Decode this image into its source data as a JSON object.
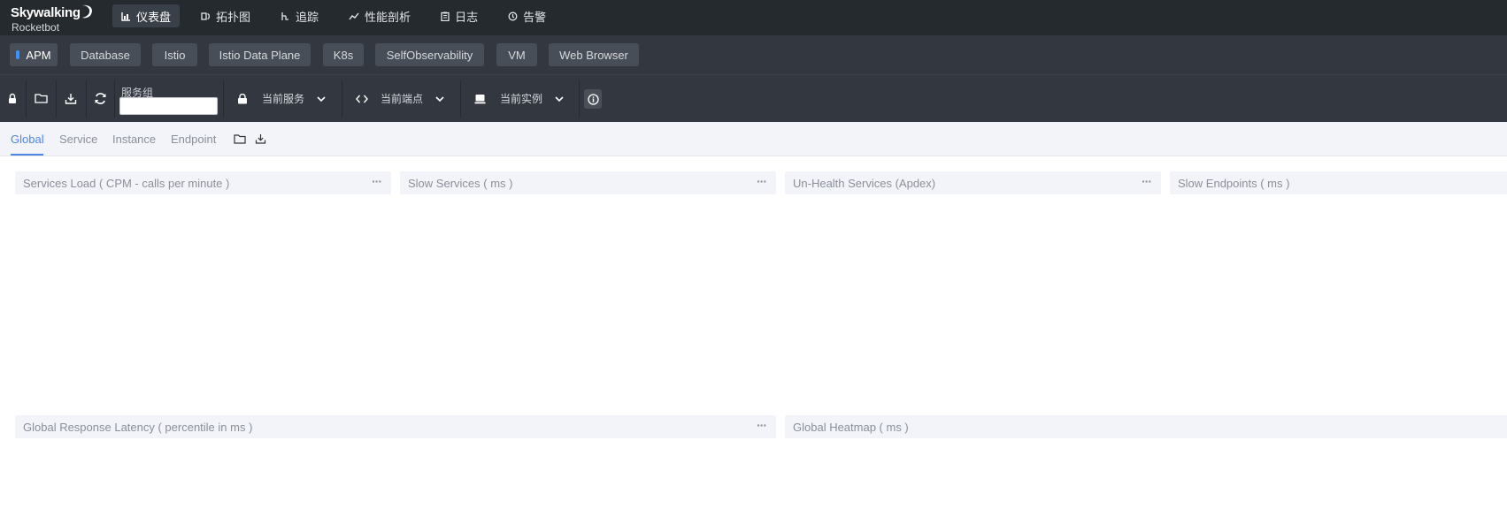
{
  "app": {
    "brand": "Skywalking",
    "subtitle": "Rocketbot"
  },
  "nav": [
    {
      "label": "仪表盘",
      "icon": "dashboard-icon",
      "active": true
    },
    {
      "label": "拓扑图",
      "icon": "topology-icon",
      "active": false
    },
    {
      "label": "追踪",
      "icon": "trace-icon",
      "active": false
    },
    {
      "label": "性能剖析",
      "icon": "profile-icon",
      "active": false
    },
    {
      "label": "日志",
      "icon": "log-icon",
      "active": false
    },
    {
      "label": "告警",
      "icon": "alarm-icon",
      "active": false
    }
  ],
  "layers": [
    {
      "label": "APM",
      "active": true
    },
    {
      "label": "Database",
      "active": false
    },
    {
      "label": "Istio",
      "active": false
    },
    {
      "label": "Istio Data Plane",
      "active": false
    },
    {
      "label": "K8s",
      "active": false
    },
    {
      "label": "SelfObservability",
      "active": false
    },
    {
      "label": "VM",
      "active": false
    },
    {
      "label": "Web Browser",
      "active": false
    }
  ],
  "toolbar": {
    "group_label": "服务组",
    "group_value": "",
    "service_label": "当前服务",
    "endpoint_label": "当前端点",
    "instance_label": "当前实例"
  },
  "dashboard_tabs": [
    {
      "label": "Global",
      "active": true
    },
    {
      "label": "Service",
      "active": false
    },
    {
      "label": "Instance",
      "active": false
    },
    {
      "label": "Endpoint",
      "active": false
    }
  ],
  "panels": [
    {
      "title": "Services Load ( CPM - calls per minute )",
      "more": "···"
    },
    {
      "title": "Slow Services ( ms )",
      "more": "···"
    },
    {
      "title": "Un-Health Services (Apdex)",
      "more": "···"
    },
    {
      "title": "Slow Endpoints ( ms )",
      "more": ""
    },
    {
      "title": "Global Response Latency ( percentile in ms )",
      "more": "···"
    },
    {
      "title": "Global Heatmap ( ms )",
      "more": ""
    }
  ],
  "colors": {
    "nav_bg": "#252a2f",
    "toolbar_bg": "#333840",
    "accent": "#4d86e0",
    "active_dot": "#3d92ff"
  }
}
